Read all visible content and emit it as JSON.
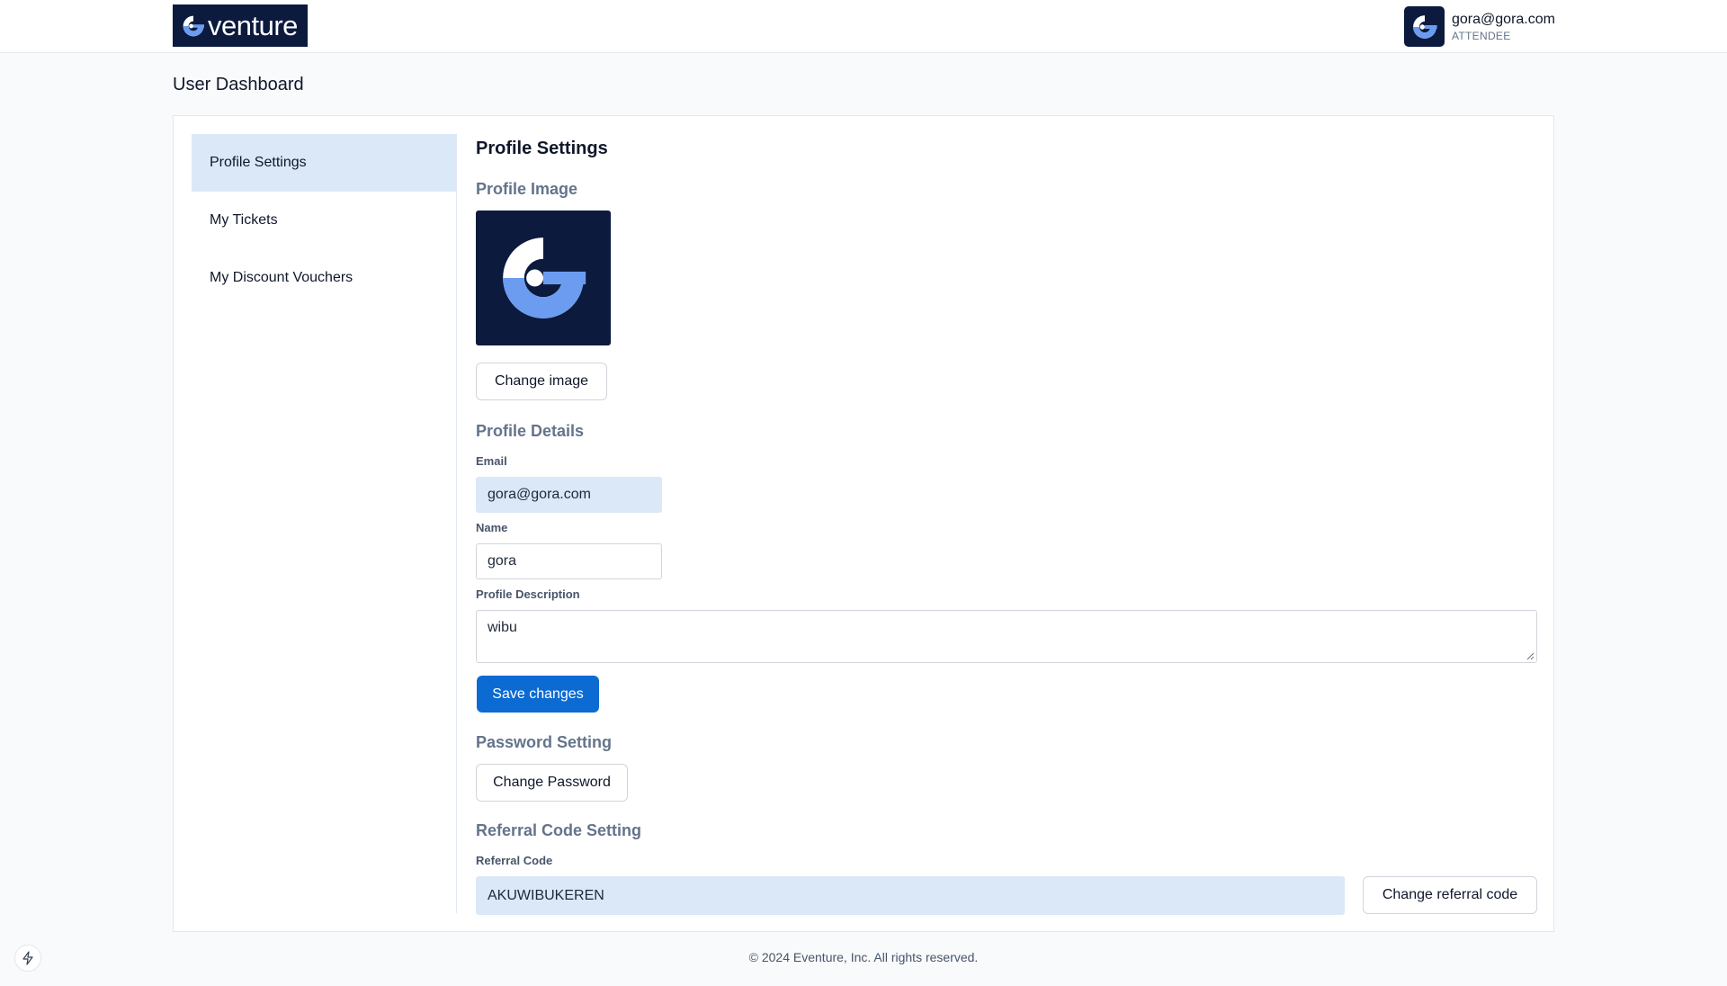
{
  "header": {
    "brand_text": "venture",
    "user_email": "gora@gora.com",
    "user_role": "ATTENDEE"
  },
  "page": {
    "title": "User Dashboard"
  },
  "sidebar": {
    "items": [
      {
        "label": "Profile Settings",
        "active": true
      },
      {
        "label": "My Tickets",
        "active": false
      },
      {
        "label": "My Discount Vouchers",
        "active": false
      }
    ]
  },
  "main": {
    "heading": "Profile Settings",
    "profile_image": {
      "title": "Profile Image",
      "change_label": "Change image"
    },
    "details": {
      "title": "Profile Details",
      "email_label": "Email",
      "email_value": "gora@gora.com",
      "name_label": "Name",
      "name_value": "gora",
      "description_label": "Profile Description",
      "description_value": "wibu",
      "save_label": "Save changes"
    },
    "password": {
      "title": "Password Setting",
      "change_label": "Change Password"
    },
    "referral": {
      "title": "Referral Code Setting",
      "code_label": "Referral Code",
      "code_value": "AKUWIBUKEREN",
      "change_label": "Change referral code"
    }
  },
  "footer": {
    "text": "© 2024 Eventure, Inc. All rights reserved."
  },
  "colors": {
    "brand_navy": "#0b1a3d",
    "accent_blue": "#6b9cf0",
    "primary_button": "#0b6bd3",
    "active_nav_bg": "#dbe8f7"
  },
  "icons": {
    "brand_logo": "eventure-logo-icon",
    "avatar": "eventure-logo-icon",
    "fab": "bolt-icon"
  }
}
